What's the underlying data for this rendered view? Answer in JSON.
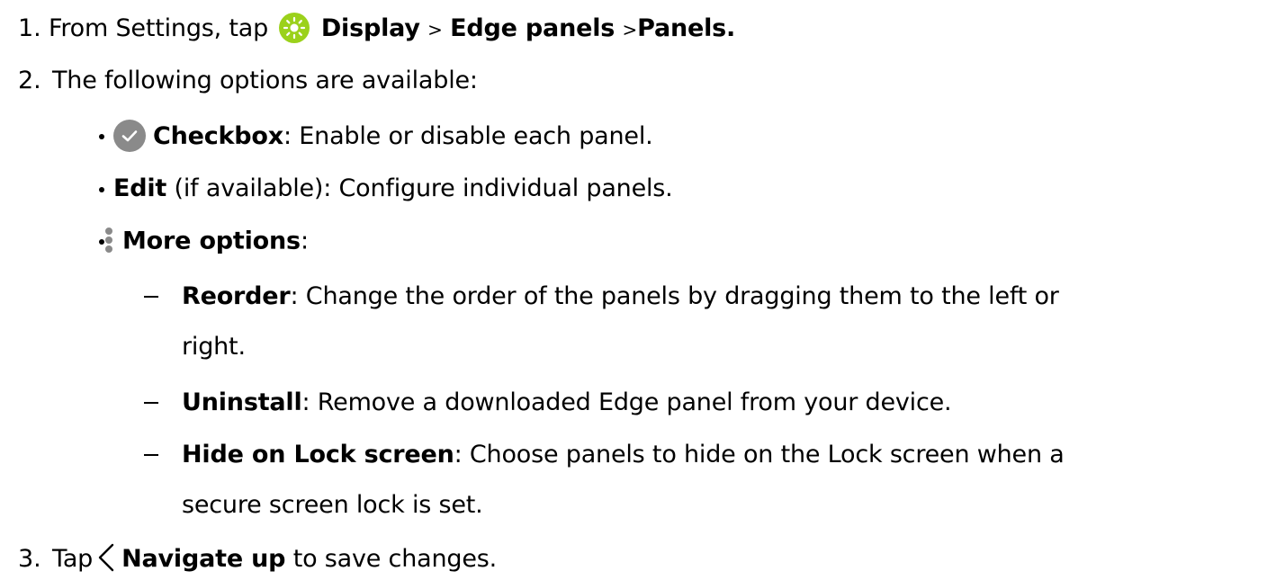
{
  "steps": {
    "s1": {
      "num": "1.",
      "pre": "From Settings, tap",
      "display": "Display",
      "sep1": ">",
      "edge": "Edge panels",
      "sep2": ">",
      "panels": "Panels",
      "end": "."
    },
    "s2": {
      "num": "2.",
      "text": "The following options are available:"
    },
    "s3": {
      "num": "3.",
      "pre": "Tap",
      "label": "Navigate up",
      "post": "to save changes."
    }
  },
  "options": {
    "checkbox": {
      "label": "Checkbox",
      "text": ": Enable or disable each panel."
    },
    "edit": {
      "label": "Edit",
      "text": " (if available): Configure individual panels."
    },
    "more": {
      "label": "More options",
      "text": ":"
    }
  },
  "more_options": {
    "reorder": {
      "label": "Reorder",
      "line1": ": Change the order of the panels by dragging them to the left or",
      "line2": "right."
    },
    "uninstall": {
      "label": "Uninstall",
      "text": ": Remove a downloaded Edge panel from your device."
    },
    "hide": {
      "label": "Hide on Lock screen",
      "line1": ": Choose panels to hide on the Lock screen when a",
      "line2": "secure screen lock is set."
    }
  },
  "icons": {
    "display": "display-settings-icon",
    "checkbox": "checkbox-checked-icon",
    "more": "more-options-icon",
    "navigate_up": "navigate-up-icon"
  },
  "colors": {
    "display_icon": "#9bd11b",
    "checkbox_icon": "#8a8a8a",
    "more_icon": "#8a8a8a",
    "text": "#000000"
  }
}
